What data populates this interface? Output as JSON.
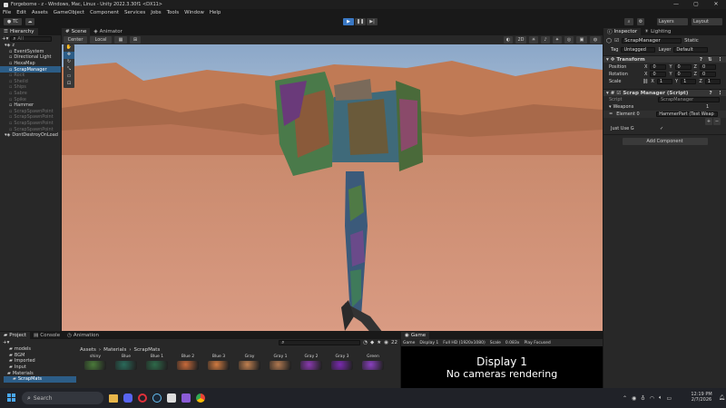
{
  "window": {
    "title": "Forgeborne - z - Windows, Mac, Linux - Unity 2022.3.30f1 <DX11>",
    "controls": [
      "—",
      "▢",
      "✕"
    ]
  },
  "menu": [
    "File",
    "Edit",
    "Assets",
    "GameObject",
    "Component",
    "Services",
    "Jobs",
    "Tools",
    "Window",
    "Help"
  ],
  "toolbar": {
    "account": "TC",
    "layers_label": "Layers",
    "layout_label": "Layout"
  },
  "hierarchy": {
    "tab_label": "Hierarchy",
    "search_placeholder": "All",
    "items": [
      {
        "label": "z",
        "dim": false,
        "sel": false,
        "indent": 1
      },
      {
        "label": "EventSystem",
        "dim": false,
        "sel": false,
        "indent": 2
      },
      {
        "label": "Directional Light",
        "dim": false,
        "sel": false,
        "indent": 2
      },
      {
        "label": "HexaMap",
        "dim": false,
        "sel": false,
        "indent": 2
      },
      {
        "label": "ScrapManager",
        "dim": false,
        "sel": true,
        "indent": 2
      },
      {
        "label": "Rock",
        "dim": true,
        "sel": false,
        "indent": 2
      },
      {
        "label": "Sheild",
        "dim": true,
        "sel": false,
        "indent": 2
      },
      {
        "label": "Ships",
        "dim": true,
        "sel": false,
        "indent": 2
      },
      {
        "label": "Sabre",
        "dim": true,
        "sel": false,
        "indent": 2
      },
      {
        "label": "Spike",
        "dim": true,
        "sel": false,
        "indent": 2
      },
      {
        "label": "Hammer",
        "dim": false,
        "sel": false,
        "indent": 2
      },
      {
        "label": "ScrapSpawnPoint",
        "dim": true,
        "sel": false,
        "indent": 2
      },
      {
        "label": "ScrapSpawnPoint",
        "dim": true,
        "sel": false,
        "indent": 2
      },
      {
        "label": "ScrapSpawnPoint",
        "dim": true,
        "sel": false,
        "indent": 2
      },
      {
        "label": "ScrapSpawnPoint",
        "dim": true,
        "sel": false,
        "indent": 2
      },
      {
        "label": "DontDestroyOnLoad",
        "dim": false,
        "sel": false,
        "indent": 1
      }
    ]
  },
  "scene": {
    "tabs": [
      "Scene",
      "Animator"
    ],
    "shading": "Center",
    "pivot": "Local",
    "mode_2d": "2D"
  },
  "inspector": {
    "tabs": [
      "Inspector",
      "Lighting"
    ],
    "object_name": "ScrapManager",
    "static_label": "Static",
    "tag_label": "Tag",
    "tag_value": "Untagged",
    "layer_label": "Layer",
    "layer_value": "Default",
    "transform_title": "Transform",
    "position_label": "Position",
    "rotation_label": "Rotation",
    "scale_label": "Scale",
    "position": {
      "x": "0",
      "y": "0",
      "z": "0"
    },
    "rotation": {
      "x": "0",
      "y": "0",
      "z": "0"
    },
    "scale": {
      "x": "1",
      "y": "1",
      "z": "1"
    },
    "axis_labels": {
      "x": "X",
      "y": "Y",
      "z": "Z"
    },
    "script_comp_title": "Scrap Manager (Script)",
    "script_label": "Script",
    "script_value": "ScrapManager",
    "weapons_label": "Weapons",
    "weapons_count": "1",
    "element_label": "Element 0",
    "element_value": "HammerPart (Test Weap",
    "just_use_label": "Just Use G",
    "checkmark": "✓",
    "plus_label": "+",
    "minus_label": "−",
    "add_component": "Add Component"
  },
  "project": {
    "tabs": [
      "Project",
      "Console",
      "Animation"
    ],
    "folders": [
      "models",
      "BGM",
      "Imported",
      "Input",
      "Materials",
      "ScrapMats"
    ],
    "breadcrumb": [
      "Assets",
      "Materials",
      "ScrapMats"
    ],
    "materials": [
      {
        "name": "shiny",
        "color": "#4a7a3a"
      },
      {
        "name": "Blue",
        "color": "#2a6a5a"
      },
      {
        "name": "Blue 1",
        "color": "#2e6a4a"
      },
      {
        "name": "Blue 2",
        "color": "#c86a3a"
      },
      {
        "name": "Blue 3",
        "color": "#d07a40"
      },
      {
        "name": "Gray",
        "color": "#c08050"
      },
      {
        "name": "Gray 1",
        "color": "#b07850"
      },
      {
        "name": "Gray 2",
        "color": "#8a3ab0"
      },
      {
        "name": "Gray 3",
        "color": "#7a2ab0"
      },
      {
        "name": "Green",
        "color": "#8a40c0"
      }
    ],
    "count_label": "22"
  },
  "game": {
    "tab_label": "Game",
    "view": "Game",
    "display": "Display 1",
    "resolution": "Full HD (1920x1080)",
    "scale_label": "Scale",
    "scale_value": "0.083x",
    "play_focused": "Play Focused",
    "overlay_title": "Display 1",
    "overlay_message": "No cameras rendering"
  },
  "taskbar": {
    "search_placeholder": "Search",
    "time": "12:19 PM",
    "date": "2/7/2026"
  },
  "colors": {
    "accent": "#2c5d87",
    "play_blue": "#3a78c4"
  }
}
